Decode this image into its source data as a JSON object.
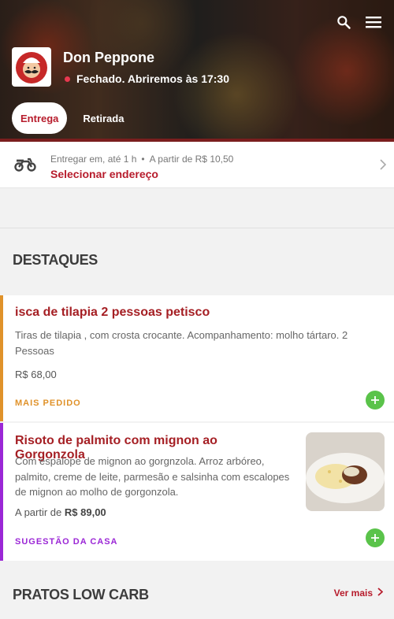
{
  "store": {
    "name": "Don Peppone",
    "status": "Fechado. Abriremos às 17:30",
    "tab_delivery": "Entrega",
    "tab_pickup": "Retirada"
  },
  "header_icons": [
    "search-icon",
    "menu-icon"
  ],
  "delivery": {
    "time": "Entregar em, até 1 h",
    "min_price": "A partir de R$ 10,50",
    "select_address": "Selecionar endereço"
  },
  "highlights": {
    "title": "DESTAQUES",
    "items": [
      {
        "name": "isca de tilapia 2 pessoas petisco",
        "description": "Tiras de tilapia , com crosta crocante. Acompanhamento: molho tártaro. 2 Pessoas",
        "price": "R$ 68,00",
        "tag": "MAIS PEDIDO",
        "tag_color": "#e0922a"
      },
      {
        "name": "Risoto de palmito com mignon ao Gorgonzola",
        "description": "Com espalope de mignon ao gorgnzola. Arroz arbóreo, palmito, creme de leite, parmesão e salsinha com escalopes de mignon ao molho de gorgonzola.",
        "price_prefix": "A partir de",
        "price": "R$ 89,00",
        "tag": "SUGESTÃO DA CASA",
        "tag_color": "#9b27d6"
      }
    ]
  },
  "low_carb": {
    "title": "PRATOS LOW CARB",
    "see_more": "Ver mais"
  },
  "colors": {
    "brand_red": "#b71c2c",
    "add_green": "#5ac34a"
  }
}
